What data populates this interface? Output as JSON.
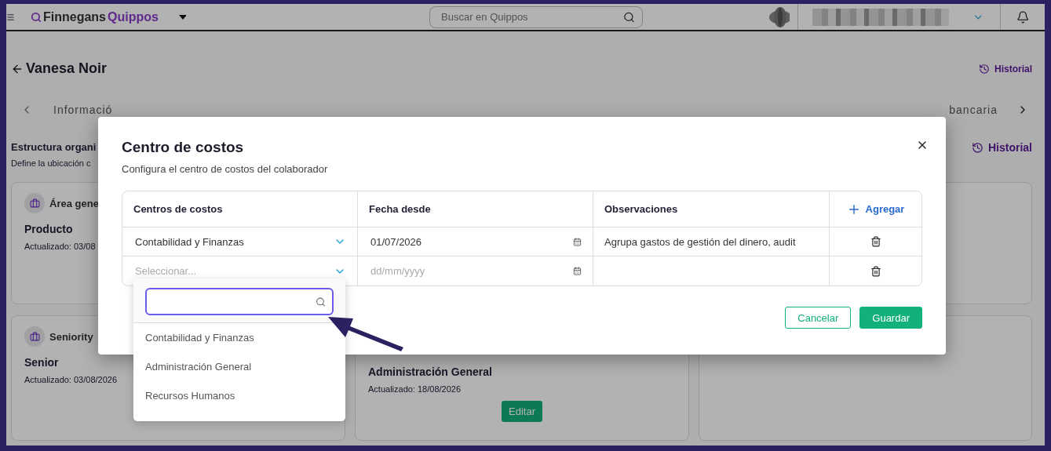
{
  "header": {
    "logo": [
      "Finnegans",
      "Quippos"
    ],
    "search": {
      "placeholder": "Buscar en Quippos"
    }
  },
  "page": {
    "title": "Vanesa Noir",
    "history": "Historial",
    "tabs": [
      "Informació",
      "bancaria"
    ],
    "section": {
      "title": "Estructura organi",
      "description": "Define la ubicación c",
      "history": "Historial"
    },
    "cards": [
      {
        "title": "Área gene",
        "value": "Producto",
        "updated": "Actualizado: 03/08"
      },
      {
        "title": "Seniority",
        "value": "Senior",
        "updated": "Actualizado: 03/08/2026"
      },
      {
        "value": "Administración General",
        "updated": "Actualizado: 18/08/2026",
        "button": "Editar"
      }
    ]
  },
  "modal": {
    "title": "Centro de costos",
    "subtitle": "Configura el centro de costos del colaborador",
    "columns": [
      "Centros de costos",
      "Fecha desde",
      "Observaciones"
    ],
    "add": "Agregar",
    "rows": [
      {
        "center": {
          "value": "Contabilidad y Finanzas"
        },
        "date": {
          "value": "01/07/2026"
        },
        "notes": "Agrupa gastos de gestión del dinero, audit"
      },
      {
        "center": {
          "placeholder": "Seleccionar...",
          "options": [
            "Contabilidad y Finanzas",
            "Administración General",
            "Recursos Humanos"
          ]
        },
        "date": {
          "placeholder": "dd/mm/yyyy"
        }
      }
    ],
    "buttons": [
      {
        "label": "Cancelar",
        "kind": "outline"
      },
      {
        "label": "Guardar",
        "kind": "primary"
      }
    ]
  }
}
